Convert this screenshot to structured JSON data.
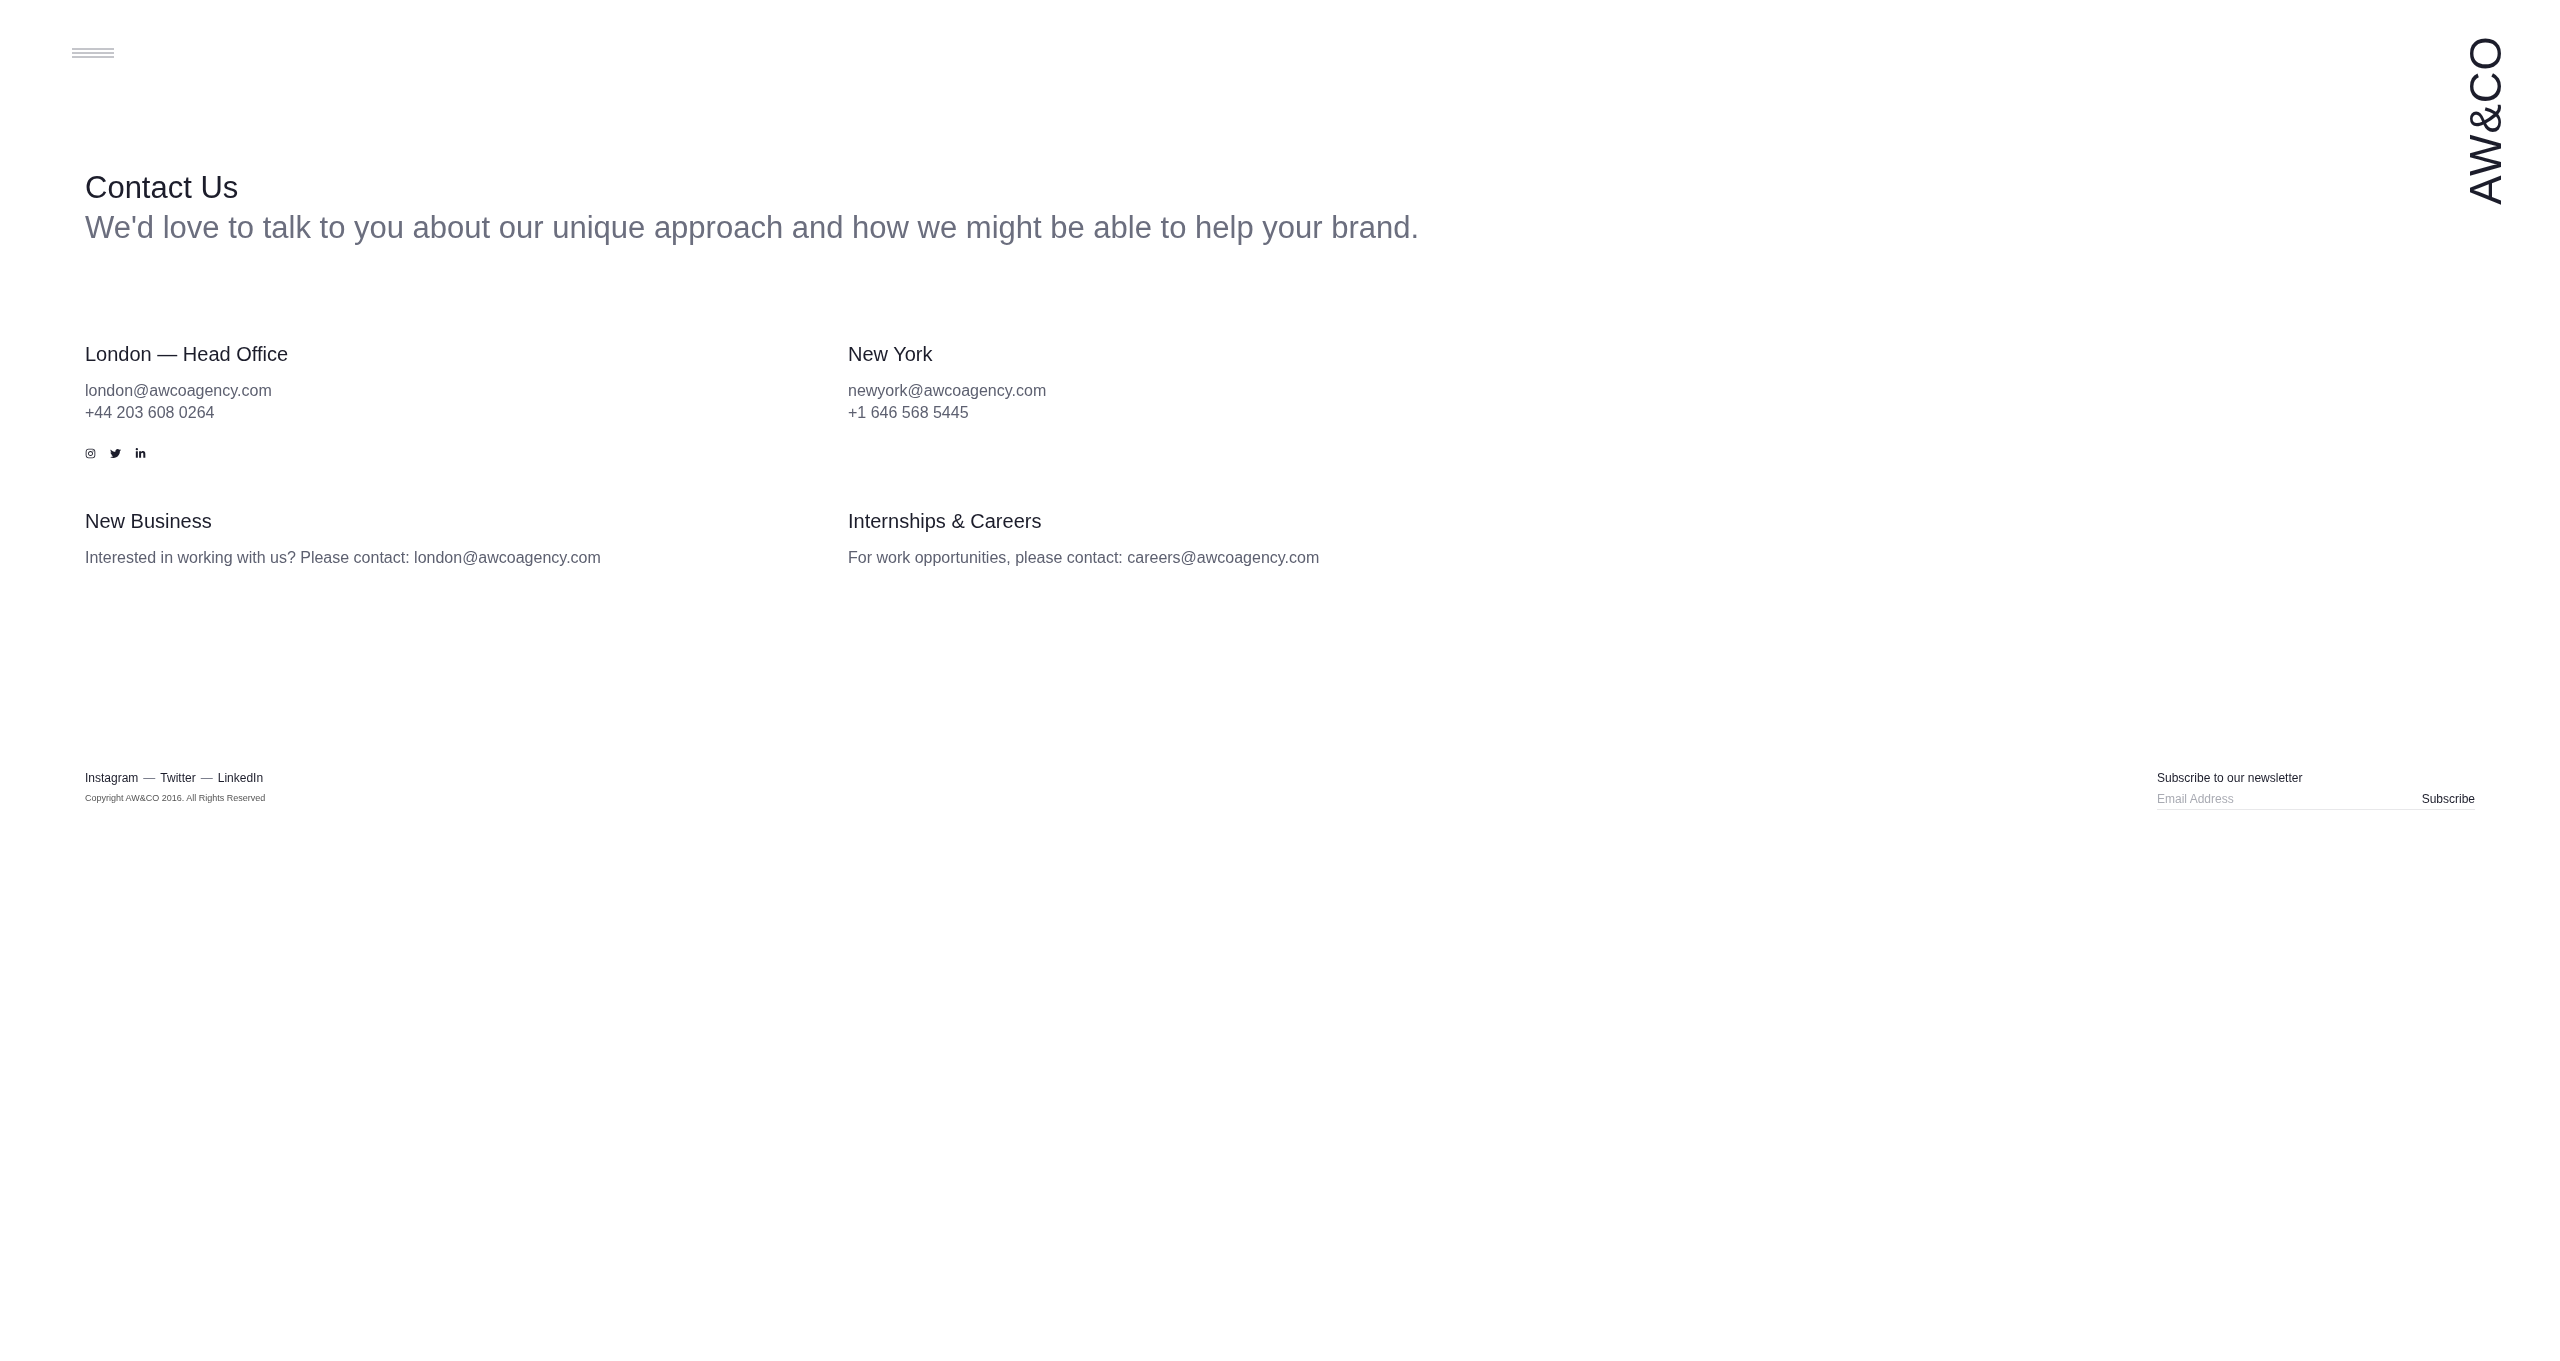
{
  "logo": {
    "text": "AW&CO"
  },
  "header": {
    "title": "Contact Us",
    "subtitle": "We'd love to talk to you about our unique approach and how we might be able to help your brand."
  },
  "offices": [
    {
      "name": "London — Head Office",
      "email": "london@awcoagency.com",
      "phone": "+44 203 608 0264",
      "social_icons": true
    },
    {
      "name": "New York",
      "email": "newyork@awcoagency.com",
      "phone": "+1 646 568 5445"
    }
  ],
  "enquiries": [
    {
      "title": "New Business",
      "text": "Interested in working with us? Please contact:",
      "email": "london@awcoagency.com"
    },
    {
      "title": "Internships & Careers",
      "text": "For work opportunities, please contact:",
      "email": "careers@awcoagency.com"
    }
  ],
  "footer": {
    "links": [
      {
        "kind": "link",
        "text": "Instagram"
      },
      {
        "kind": "separator",
        "text": "—"
      },
      {
        "kind": "link",
        "text": "Twitter"
      },
      {
        "kind": "separator",
        "text": "—"
      },
      {
        "kind": "link",
        "text": "LinkedIn"
      }
    ],
    "copyright": "Copyright AW&CO 2016. All Rights Reserved"
  },
  "newsletter": {
    "label": "Subscribe to our newsletter",
    "placeholder": "Email Address",
    "button": "Subscribe"
  }
}
